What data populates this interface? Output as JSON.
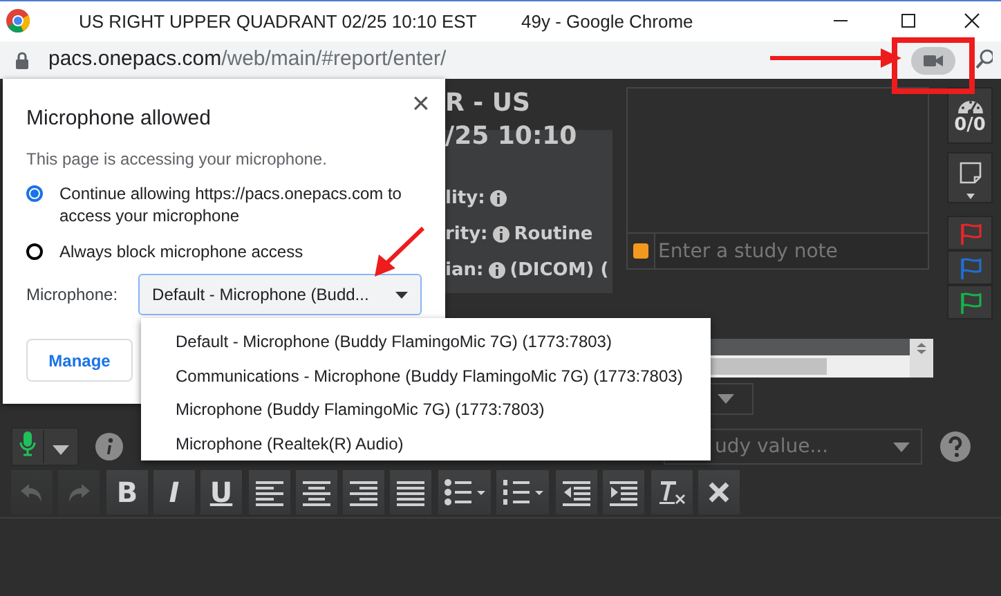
{
  "window": {
    "title": "US RIGHT UPPER QUADRANT 02/25 10:10 EST",
    "app_title": "49y - Google Chrome"
  },
  "address_bar": {
    "host": "pacs.onepacs.com",
    "path": "/web/main/#report/enter/"
  },
  "report_header": {
    "title_lines": [
      "R - US",
      "/25 10:10"
    ],
    "fields": [
      {
        "label": "lity:"
      },
      {
        "label": "rity:",
        "value": "Routine"
      },
      {
        "label": "ian:",
        "value": "(DICOM) ("
      }
    ]
  },
  "study_note": {
    "placeholder": "Enter a study note"
  },
  "sidebar": {
    "counter": "0/0",
    "flags": [
      {
        "color": "#e8262a"
      },
      {
        "color": "#1f6fd6"
      },
      {
        "color": "#17b34a"
      }
    ]
  },
  "value_select": {
    "placeholder": "udy value..."
  },
  "toolbar": [
    [
      {
        "kind": "undo",
        "disabled": true
      },
      {
        "kind": "redo",
        "disabled": true
      }
    ],
    [
      {
        "kind": "bold",
        "label": "B",
        "disabled": false
      },
      {
        "kind": "italic",
        "label": "I",
        "disabled": false
      },
      {
        "kind": "underline",
        "label": "U",
        "disabled": false
      }
    ],
    [
      {
        "kind": "align-left",
        "disabled": false
      },
      {
        "kind": "align-center",
        "disabled": false
      },
      {
        "kind": "align-right",
        "disabled": false
      },
      {
        "kind": "justify",
        "disabled": false
      }
    ],
    [
      {
        "kind": "bullet-list",
        "disabled": false
      },
      {
        "kind": "numbered-list",
        "disabled": false
      }
    ],
    [
      {
        "kind": "outdent",
        "disabled": false
      },
      {
        "kind": "indent",
        "disabled": false
      }
    ],
    [
      {
        "kind": "clear-format",
        "disabled": false
      },
      {
        "kind": "remove",
        "disabled": false
      }
    ]
  ],
  "permission_popup": {
    "title": "Microphone allowed",
    "close": "×",
    "description": "This page is accessing your microphone.",
    "options": [
      {
        "label": "Continue allowing https://pacs.onepacs.com to access your microphone",
        "selected": true
      },
      {
        "label": "Always block microphone access",
        "selected": false
      }
    ],
    "microphone_label": "Microphone:",
    "microphone_value": "Default - Microphone (Budd...",
    "manage_button": "Manage"
  },
  "microphone_menu": {
    "options": [
      {
        "label": "Default - Microphone (Buddy FlamingoMic 7G) (1773:7803)"
      },
      {
        "label": "Communications - Microphone (Buddy FlamingoMic 7G) (1773:7803)"
      },
      {
        "label": "Microphone (Buddy FlamingoMic 7G) (1773:7803)"
      },
      {
        "label": "Microphone (Realtek(R) Audio)"
      }
    ]
  },
  "annotations": [
    {
      "kind": "arrow-right"
    },
    {
      "kind": "box"
    },
    {
      "kind": "arrow-down-left"
    }
  ]
}
